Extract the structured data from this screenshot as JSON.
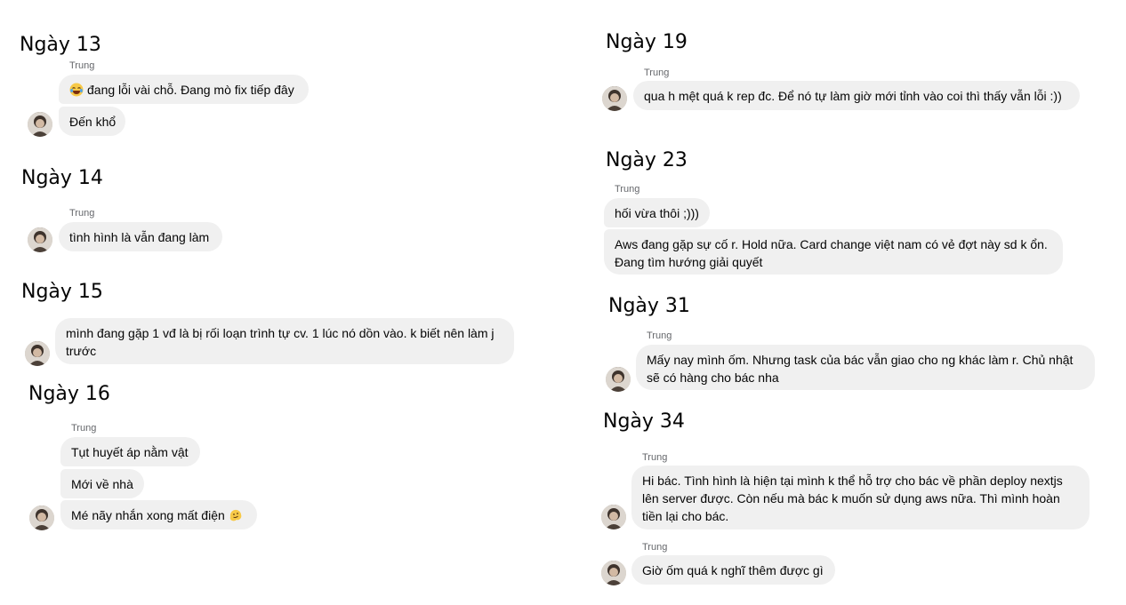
{
  "days": [
    {
      "title": "Ngày 13",
      "sender": "Trung",
      "messages": [
        "đang lỗi vài chỗ. Đang mò fix tiếp đây",
        "Đến khổ"
      ],
      "emoji": [
        "laughing-tears-emoji"
      ]
    },
    {
      "title": "Ngày 14",
      "sender": "Trung",
      "messages": [
        "tình hình là vẫn đang làm"
      ]
    },
    {
      "title": "Ngày 15",
      "messages": [
        "mình đang gặp 1 vđ là bị rối loạn trình tự cv. 1 lúc nó dồn vào. k biết nên làm j trước"
      ]
    },
    {
      "title": "Ngày 16",
      "sender": "Trung",
      "messages": [
        "Tụt huyết áp nằm vật",
        "Mới về nhà",
        "Mé nãy nhắn xong mất điện"
      ],
      "emoji": [
        "melting-face-emoji"
      ]
    },
    {
      "title": "Ngày 19",
      "sender": "Trung",
      "messages": [
        "qua h mệt quá k rep đc. Để nó tự làm giờ mới tỉnh vào coi thì thấy vẫn lỗi :))"
      ]
    },
    {
      "title": "Ngày 23",
      "sender": "Trung",
      "messages": [
        "hối vừa thôi ;)))",
        "Aws đang gặp sự cố r. Hold nữa. Card change việt nam có vẻ đợt này sd k ổn. Đang tìm hướng giải quyết"
      ]
    },
    {
      "title": "Ngày 31",
      "sender": "Trung",
      "messages": [
        "Mấy nay mình ốm. Nhưng task của bác vẫn giao cho ng khác làm r. Chủ nhật sẽ có hàng cho bác nha"
      ]
    },
    {
      "title": "Ngày 34",
      "sender": "Trung",
      "sender2": "Trung",
      "messages": [
        "Hi bác. Tình hình là hiện tại mình k thể hỗ trợ cho bác về phần deploy nextjs lên server được. Còn nếu mà bác k muốn sử dụng aws nữa. Thì mình hoàn tiền lại cho bác.",
        "Giờ ốm quá k nghĩ thêm được gì"
      ]
    }
  ],
  "colors": {
    "bubble": "#f0f0f0",
    "sender": "#65676b",
    "text": "#050505"
  }
}
